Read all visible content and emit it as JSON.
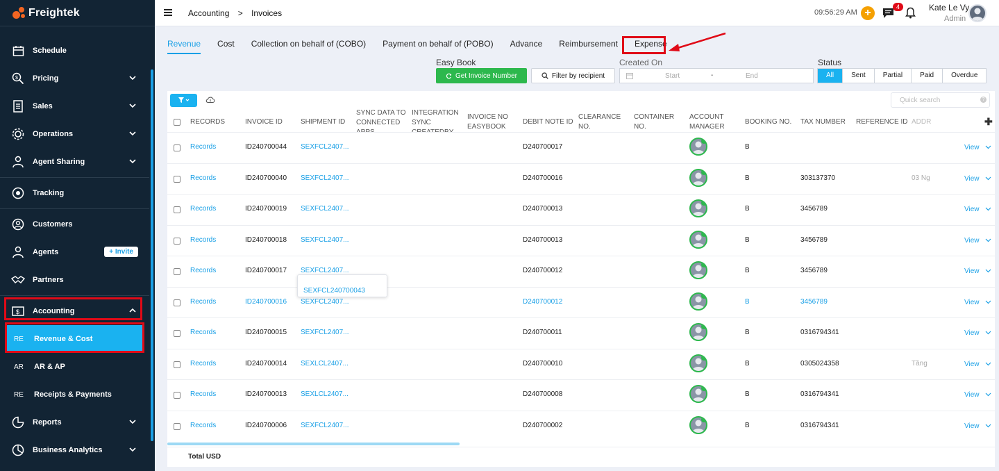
{
  "sidebar": {
    "brand": "Freightek",
    "items": [
      {
        "label": "Schedule",
        "icon": "calendar-icon"
      },
      {
        "label": "Pricing",
        "icon": "pricing-icon"
      },
      {
        "label": "Sales",
        "icon": "sales-icon"
      },
      {
        "label": "Operations",
        "icon": "operations-icon"
      },
      {
        "label": "Agent Sharing",
        "icon": "agent-sharing-icon"
      },
      {
        "label": "Tracking",
        "icon": "tracking-icon"
      },
      {
        "label": "Customers",
        "icon": "customers-icon"
      },
      {
        "label": "Agents",
        "icon": "agents-icon"
      },
      {
        "label": "Partners",
        "icon": "partners-icon"
      },
      {
        "label": "Accounting",
        "icon": "accounting-icon"
      },
      {
        "label": "Reports",
        "icon": "reports-icon"
      },
      {
        "label": "Business Analytics",
        "icon": "analytics-icon"
      }
    ],
    "invite_label": "+ Invite",
    "sub_items": [
      {
        "abbr": "RE",
        "label": "Revenue & Cost"
      },
      {
        "abbr": "AR",
        "label": "AR & AP"
      },
      {
        "abbr": "RE",
        "label": "Receipts & Payments"
      }
    ]
  },
  "header": {
    "breadcrumb": [
      "Accounting",
      ">",
      "Invoices"
    ],
    "time": "09:56:29 AM",
    "notification_count": "4",
    "user_name": "Kate Le Vy",
    "user_role": "Admin"
  },
  "tabs": [
    "Revenue",
    "Cost",
    "Collection on behalf of (COBO)",
    "Payment on behalf of (POBO)",
    "Advance",
    "Reimbursement",
    "Expense"
  ],
  "filters": {
    "easy_book_label": "Easy Book",
    "get_invoice_label": "Get Invoice Number",
    "filter_recipient_label": "Filter by recipient",
    "created_on_label": "Created On",
    "start_placeholder": "Start",
    "end_placeholder": "End",
    "range_sep": "-",
    "status_label": "Status",
    "status_options": [
      "All",
      "Sent",
      "Partial",
      "Paid",
      "Overdue"
    ],
    "quick_search_placeholder": "Quick search"
  },
  "table": {
    "columns": [
      "RECORDS",
      "INVOICE ID",
      "SHIPMENT ID",
      "SYNC DATA TO CONNECTED APPS",
      "INTEGRATION SYNC CREATEDBY",
      "INVOICE NO EASYBOOK",
      "DEBIT NOTE ID",
      "CLEARANCE NO.",
      "CONTAINER NO.",
      "ACCOUNT MANAGER",
      "BOOKING NO.",
      "TAX NUMBER",
      "REFERENCE ID",
      "ADDR"
    ],
    "rows": [
      {
        "records": "Records",
        "invoice": "ID240700044",
        "shipment": "SEXFCL2407...",
        "debit": "D240700017",
        "booking": "B",
        "tax": "",
        "addr": "",
        "view": "View"
      },
      {
        "records": "Records",
        "invoice": "ID240700040",
        "shipment": "SEXFCL2407...",
        "debit": "D240700016",
        "booking": "B",
        "tax": "303137370",
        "addr": "03 Ng",
        "view": "View"
      },
      {
        "records": "Records",
        "invoice": "ID240700019",
        "shipment": "SEXFCL2407...",
        "debit": "D240700013",
        "booking": "B",
        "tax": "3456789",
        "addr": "",
        "view": "View"
      },
      {
        "records": "Records",
        "invoice": "ID240700018",
        "shipment": "SEXFCL2407...",
        "debit": "D240700013",
        "booking": "B",
        "tax": "3456789",
        "addr": "",
        "view": "View"
      },
      {
        "records": "Records",
        "invoice": "ID240700017",
        "shipment": "SEXFCL2407...",
        "debit": "D240700012",
        "booking": "B",
        "tax": "3456789",
        "addr": "",
        "view": "View"
      },
      {
        "records": "Records",
        "invoice": "ID240700016",
        "shipment": "SEXFCL2407...",
        "debit": "D240700012",
        "booking": "B",
        "tax": "3456789",
        "addr": "",
        "view": "View"
      },
      {
        "records": "Records",
        "invoice": "ID240700015",
        "shipment": "SEXFCL2407...",
        "debit": "D240700011",
        "booking": "B",
        "tax": "0316794341",
        "addr": "",
        "view": "View"
      },
      {
        "records": "Records",
        "invoice": "ID240700014",
        "shipment": "SEXLCL2407...",
        "debit": "D240700010",
        "booking": "B",
        "tax": "0305024358",
        "addr": "Tầng",
        "view": "View"
      },
      {
        "records": "Records",
        "invoice": "ID240700013",
        "shipment": "SEXLCL2407...",
        "debit": "D240700008",
        "booking": "B",
        "tax": "0316794341",
        "addr": "",
        "view": "View"
      },
      {
        "records": "Records",
        "invoice": "ID240700006",
        "shipment": "SEXFCL2407...",
        "debit": "D240700002",
        "booking": "B",
        "tax": "0316794341",
        "addr": "",
        "view": "View"
      }
    ],
    "tooltip": "SEXFCL240700043",
    "total_label": "Total USD"
  }
}
